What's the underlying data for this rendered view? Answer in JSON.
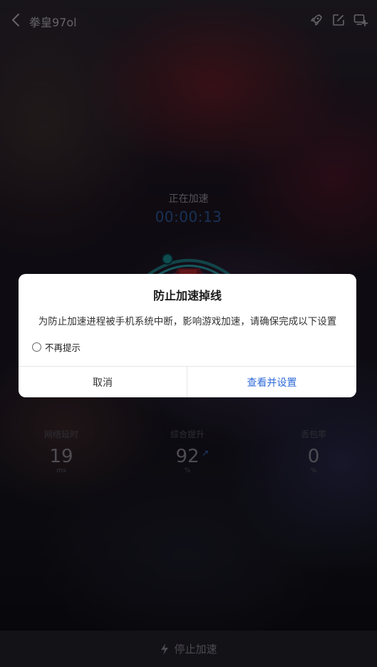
{
  "header": {
    "title": "拳皇97ol",
    "icons": [
      "back-arrow-icon",
      "rocket-icon",
      "edit-icon",
      "add-shortcut-icon"
    ]
  },
  "status": {
    "label": "正在加速",
    "timer": "00:00:13"
  },
  "stats": [
    {
      "label": "网络延时",
      "value": "19",
      "unit": "ms"
    },
    {
      "label": "综合提升",
      "value": "92",
      "unit": "%"
    },
    {
      "label": "丢包率",
      "value": "0",
      "unit": "%"
    }
  ],
  "footer": {
    "stop_label": "停止加速"
  },
  "dialog": {
    "title": "防止加速掉线",
    "message": "为防止加速进程被手机系统中断，影响游戏加速，请确保完成以下设置",
    "checkbox_label": "不再提示",
    "checkbox_checked": false,
    "cancel_label": "取消",
    "confirm_label": "查看并设置"
  },
  "colors": {
    "accent": "#2f6bd8",
    "timer": "#2e5a9e",
    "dialog_bg": "#ffffff"
  }
}
